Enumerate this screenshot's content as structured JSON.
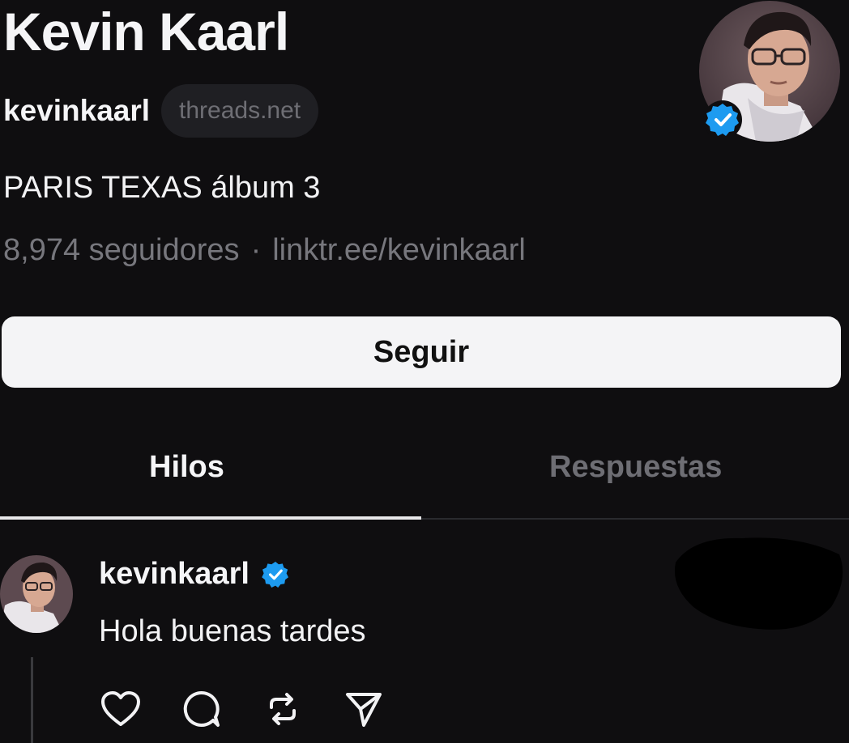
{
  "profile": {
    "display_name": "Kevin Kaarl",
    "handle": "kevinkaarl",
    "domain_badge": "threads.net",
    "bio": "PARIS TEXAS álbum 3",
    "followers": "8,974 seguidores",
    "separator": "·",
    "link": "linktr.ee/kevinkaarl",
    "verified": true,
    "avatar_icon": "profile-photo",
    "verified_icon": "verified-check-icon"
  },
  "actions": {
    "follow_label": "Seguir"
  },
  "tabs": [
    {
      "label": "Hilos",
      "active": true
    },
    {
      "label": "Respuestas",
      "active": false
    }
  ],
  "post": {
    "username": "kevinkaarl",
    "verified": true,
    "text": "Hola buenas tardes",
    "action_icons": [
      "heart-icon",
      "comment-icon",
      "repost-icon",
      "share-icon"
    ]
  },
  "colors": {
    "background": "#0f0e10",
    "verified_blue": "#1d9bf0",
    "button_bg": "#f4f4f6",
    "muted_text": "#77777d"
  }
}
